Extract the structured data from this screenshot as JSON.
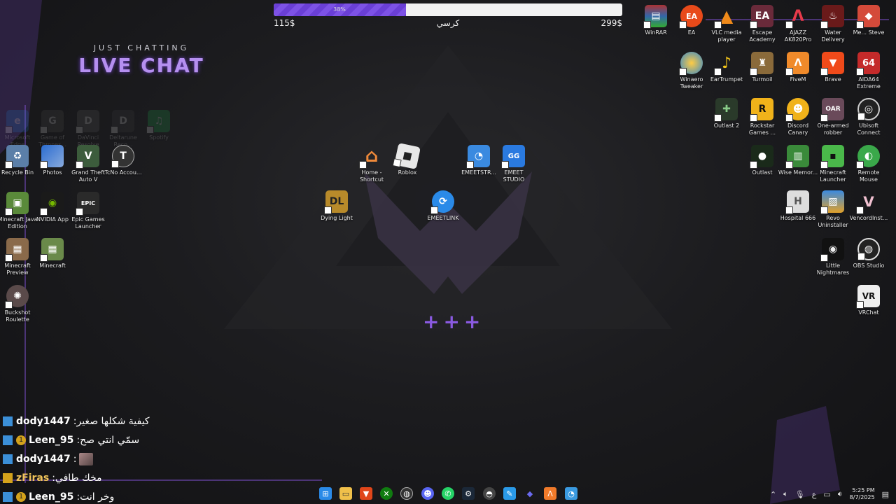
{
  "brand": {
    "subtitle": "JUST CHATTING",
    "title": "LIVE CHAT"
  },
  "goal": {
    "percent_label": "38%",
    "progress": 0.38,
    "start": "115$",
    "name": "كرسي",
    "target": "299$"
  },
  "desktop": {
    "icons": [
      {
        "label": "Microsoft Edge",
        "faded": true
      },
      {
        "label": "Game of Thrones...",
        "faded": true
      },
      {
        "label": "DaVinci Resolve",
        "faded": true
      },
      {
        "label": "Deltarune Reco...",
        "faded": true
      },
      {
        "label": "Spotify",
        "faded": true
      },
      {
        "label": "Recycle Bin"
      },
      {
        "label": "Photos"
      },
      {
        "label": "Grand Theft Auto V"
      },
      {
        "label": "TcNo Accou..."
      },
      {
        "label": "Minecraft Java Edition"
      },
      {
        "label": "NVIDIA App"
      },
      {
        "label": "Epic Games Launcher"
      },
      {
        "label": "Minecraft Preview"
      },
      {
        "label": "Minecraft"
      },
      {
        "label": "Buckshot Roulette"
      },
      {
        "label": "Home - Shortcut"
      },
      {
        "label": "Roblox"
      },
      {
        "label": "EMEETSTR..."
      },
      {
        "label": "EMEET STUDIO"
      },
      {
        "label": "Dying Light"
      },
      {
        "label": "EMEETLINK"
      },
      {
        "label": "WinRAR"
      },
      {
        "label": "EA"
      },
      {
        "label": "VLC media player"
      },
      {
        "label": "Escape Academy"
      },
      {
        "label": "AJAZZ AK820Pro"
      },
      {
        "label": "Water Delivery"
      },
      {
        "label": "Me... Steve"
      },
      {
        "label": "Winaero Tweaker"
      },
      {
        "label": "EarTrumpet"
      },
      {
        "label": "Turmoil"
      },
      {
        "label": "FiveM"
      },
      {
        "label": "Brave"
      },
      {
        "label": "AIDA64 Extreme"
      },
      {
        "label": "Outlast 2"
      },
      {
        "label": "Rockstar Games ..."
      },
      {
        "label": "Discord Canary"
      },
      {
        "label": "One-armed robber"
      },
      {
        "label": "Ubisoft Connect"
      },
      {
        "label": "Outlast"
      },
      {
        "label": "Wise Memor..."
      },
      {
        "label": "Minecraft Launcher"
      },
      {
        "label": "Remote Mouse"
      },
      {
        "label": "Hospital 666"
      },
      {
        "label": "Revo Uninstaller"
      },
      {
        "label": "VencordInst..."
      },
      {
        "label": "Little Nightmares"
      },
      {
        "label": "OBS Studio"
      },
      {
        "label": "VRChat"
      }
    ],
    "plus_text": "+++"
  },
  "chat": [
    {
      "user": "dody1447",
      "msg": "كيفية شكلها صغير",
      "badge": ""
    },
    {
      "user": "Leen_95",
      "msg": "سمّي انتي صح",
      "badge": "1"
    },
    {
      "user": "dody1447",
      "msg": "",
      "badge": "",
      "emote": true
    },
    {
      "user": "zFiras",
      "msg": "مخك طافي",
      "badge": "",
      "gold": true
    },
    {
      "user": "Leen_95",
      "msg": "وخر انت",
      "badge": "1"
    }
  ],
  "chat_separator": " : ",
  "tray": {
    "lang": "ع",
    "time": "5:25 PM",
    "date": "8/7/2025"
  },
  "colors": {
    "accent": "#7b4fc9",
    "bar_fill": "#6a3fd6",
    "twitch_blue": "#3b8fd8",
    "sub_gold": "#d4a21b"
  }
}
